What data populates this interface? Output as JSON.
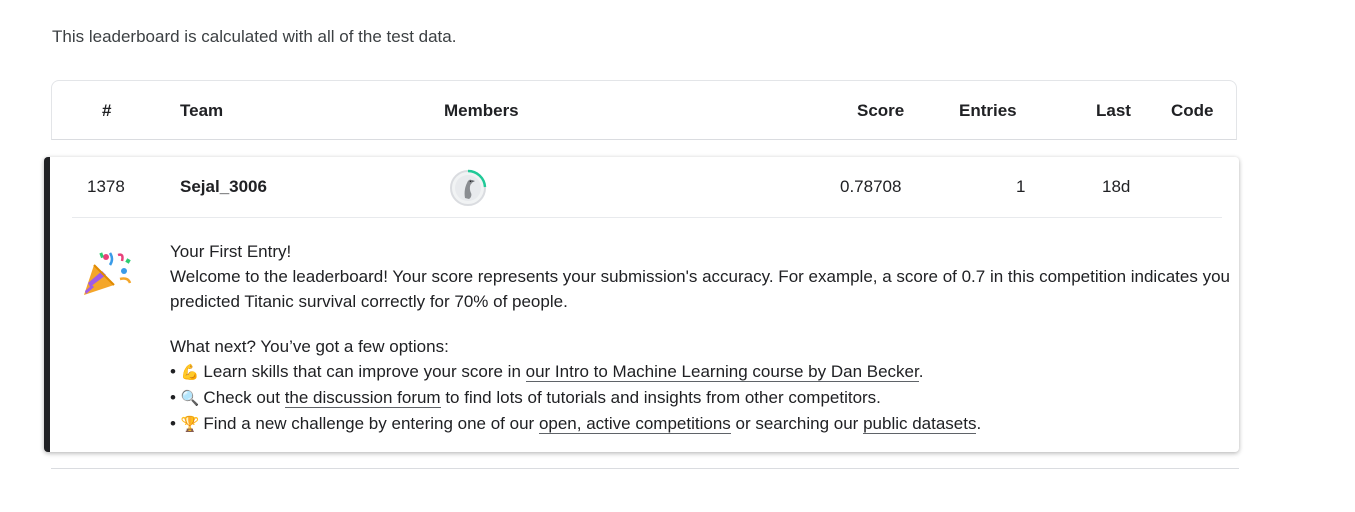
{
  "intro_text": "This leaderboard is calculated with all of the test data.",
  "columns": {
    "rank": "#",
    "team": "Team",
    "members": "Members",
    "score": "Score",
    "entries": "Entries",
    "last": "Last",
    "code": "Code"
  },
  "row": {
    "rank": "1378",
    "team": "Sejal_3006",
    "score": "0.78708",
    "entries": "1",
    "last": "18d",
    "avatar_icon": "goose-avatar-icon",
    "progress_color": "#20beff"
  },
  "message": {
    "title": "Your First Entry!",
    "body": "Welcome to the leaderboard! Your score represents your submission's accuracy. For example, a score of 0.7 in this competition indicates you predicted Titanic survival correctly for 70% of people.",
    "next_heading": "What next? You’ve got a few options:",
    "options": [
      {
        "emoji": "💪",
        "pre": "Learn skills that can improve your score in ",
        "link": "our Intro to Machine Learning course by Dan Becker",
        "post": "."
      },
      {
        "emoji": "🔍",
        "pre": "Check out ",
        "link": "the discussion forum",
        "post": " to find lots of tutorials and insights from other competitors."
      },
      {
        "emoji": "🏆",
        "pre": "Find a new challenge by entering one of our ",
        "link": "open, active competitions",
        "mid": " or searching our ",
        "link2": "public datasets",
        "post": "."
      }
    ]
  },
  "colors": {
    "accent_border": "#202124",
    "progress_ring": "#20c997"
  }
}
